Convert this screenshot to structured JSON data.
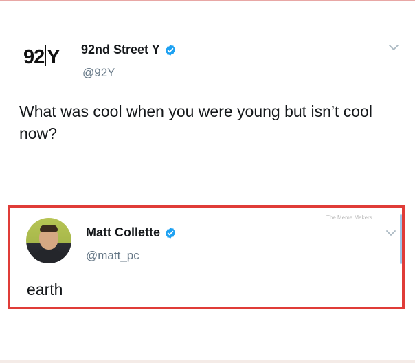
{
  "main_tweet": {
    "logo_text_left": "92",
    "logo_text_right": "Y",
    "display_name": "92nd Street Y",
    "handle": "@92Y",
    "text": "What was cool when you were young but isn’t cool now?",
    "verified_icon": "verified-badge-icon",
    "menu_icon": "chevron-down-icon"
  },
  "reply_tweet": {
    "display_name": "Matt Collette",
    "handle": "@matt_pc",
    "text": "earth",
    "watermark": "The Meme Makers",
    "verified_icon": "verified-badge-icon",
    "menu_icon": "chevron-down-icon"
  },
  "colors": {
    "verified_blue": "#1da1f2",
    "highlight_border": "#e03c38",
    "secondary_text": "#657786"
  }
}
